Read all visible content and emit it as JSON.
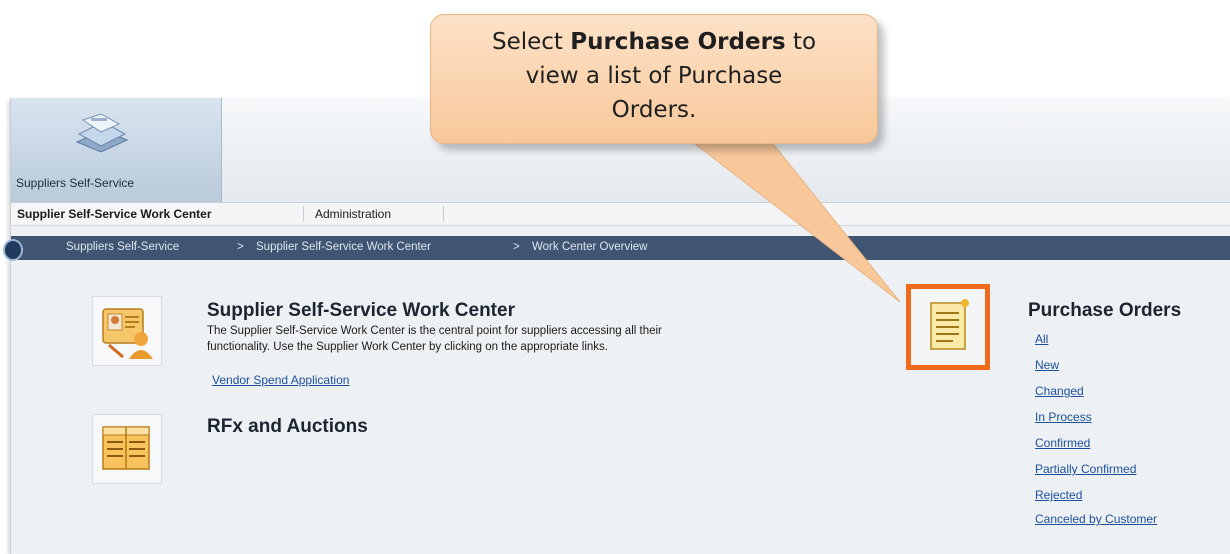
{
  "app_tile": {
    "label": "Suppliers Self-Service",
    "icon": "folders-icon"
  },
  "tabs": [
    {
      "label": "Supplier Self-Service Work Center",
      "active": true
    },
    {
      "label": "Administration",
      "active": false
    }
  ],
  "breadcrumb": {
    "items": [
      "Suppliers Self-Service",
      "Supplier Self-Service Work Center",
      "Work Center Overview"
    ],
    "separator": ">"
  },
  "work_center": {
    "title": "Supplier Self-Service Work Center",
    "description_line1": "The Supplier Self-Service Work Center is the central point for suppliers accessing all their",
    "description_line2": "functionality. Use the Supplier Work Center by clicking on the appropriate links.",
    "link": "Vendor Spend Application",
    "icon": "supplier-card-icon"
  },
  "rfx": {
    "title": "RFx and Auctions",
    "icon": "rfx-table-icon"
  },
  "purchase_orders": {
    "title": "Purchase Orders",
    "icon": "document-icon",
    "links": [
      "All",
      "New",
      "Changed",
      "In Process",
      "Confirmed",
      "Partially Confirmed",
      "Rejected",
      "Canceled by Customer"
    ]
  },
  "callout": {
    "text_before": "Select ",
    "text_bold": "Purchase Orders",
    "text_after_line1": " to",
    "line2": "view a list of Purchase",
    "line3": "Orders."
  },
  "colors": {
    "highlight": "#ef6a1c",
    "breadcrumb_bg": "#3f5572",
    "link": "#1c4f9c",
    "callout_bg": "#f8c89a"
  }
}
